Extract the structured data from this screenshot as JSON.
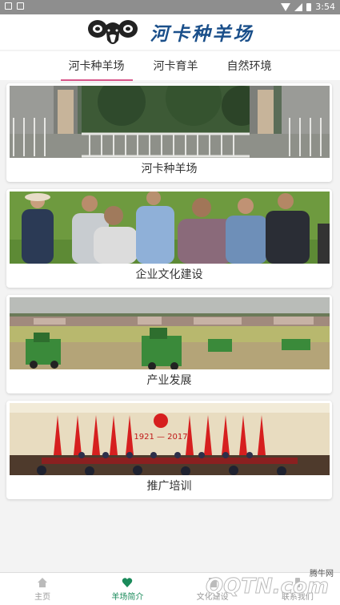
{
  "status_bar": {
    "time": "3:54"
  },
  "header": {
    "title": "河卡种羊场",
    "logo_icon": "ram-head-icon"
  },
  "tabs": [
    {
      "label": "河卡种羊场",
      "active": true
    },
    {
      "label": "河卡育羊",
      "active": false
    },
    {
      "label": "自然环境",
      "active": false
    }
  ],
  "cards": [
    {
      "caption": "河卡种羊场",
      "image": "farm-gate-photo"
    },
    {
      "caption": "企业文化建设",
      "image": "people-meeting-photo"
    },
    {
      "caption": "产业发展",
      "image": "harvesters-photo"
    },
    {
      "caption": "推广培训",
      "image": "conference-hall-photo"
    }
  ],
  "conference_banner": "1921 — 2017",
  "bottom_nav": [
    {
      "label": "主页",
      "icon": "home-icon",
      "active": false
    },
    {
      "label": "羊场简介",
      "icon": "heart-icon",
      "active": true
    },
    {
      "label": "文化建设",
      "icon": "book-icon",
      "active": false
    },
    {
      "label": "联系我们",
      "icon": "phone-icon",
      "active": false
    }
  ],
  "watermark": {
    "main": "QQTN.com",
    "small": "腾牛网"
  },
  "colors": {
    "accent_title": "#1a4f8a",
    "tab_indicator": "#d8578a",
    "nav_active": "#1a8a5a"
  }
}
